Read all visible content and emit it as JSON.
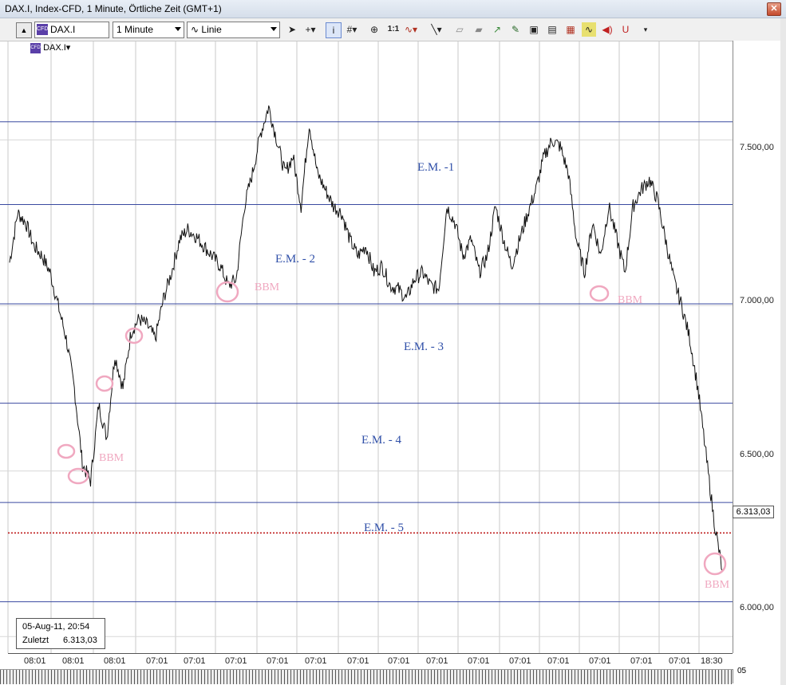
{
  "window": {
    "title": "DAX.I, Index-CFD, 1 Minute, Örtliche Zeit (GMT+1)",
    "close_icon": "close-icon"
  },
  "toolbar": {
    "symbol": "DAX.I",
    "interval": "1 Minute",
    "chart_style": "Linie",
    "icons": [
      "cursor-icon",
      "crosshair-icon",
      "info-icon",
      "grid-icon",
      "zoom-icon",
      "one-to-one-icon",
      "indicator-icon",
      "trendline-icon",
      "eraser-icon",
      "eraser2-icon",
      "fib-icon",
      "draw-icon",
      "copy-icon",
      "paste-icon",
      "print-icon",
      "wave-icon",
      "sound-icon",
      "magnet-icon",
      "more-icon"
    ],
    "one_to_one_label": "1:1"
  },
  "legend": {
    "label": "DAX.I"
  },
  "info": {
    "datetime": "05-Aug-11, 20:54",
    "last_label": "Zuletzt",
    "last_value": "6.313,03"
  },
  "price_axis": {
    "ticks": [
      "7.500,00",
      "7.000,00",
      "6.500,00",
      "6.000,00"
    ],
    "last_price": "6.313,03"
  },
  "time_axis": {
    "ticks": [
      "08:01",
      "08:01",
      "08:01",
      "07:01",
      "07:01",
      "07:01",
      "07:01",
      "07:01",
      "07:01",
      "07:01",
      "07:01",
      "07:01",
      "07:01",
      "07:01",
      "07:01",
      "07:01",
      "07:01",
      "18:30"
    ],
    "corner": "05"
  },
  "annotations": {
    "em": [
      "E.M. -1",
      "E.M. - 2",
      "E.M. - 3",
      "E.M. - 4",
      "E.M. - 5"
    ],
    "bbm": [
      "BBM",
      "BBM",
      "BBM",
      "BBM"
    ]
  },
  "chart_data": {
    "type": "line",
    "series": [
      {
        "values": [
          7130,
          7280,
          7250,
          7180,
          7150,
          7100,
          7000,
          6900,
          6750,
          6520,
          6470,
          6700,
          6600,
          6850,
          6750,
          6920,
          6960,
          6940,
          6900,
          7020,
          7100,
          7200,
          7230,
          7210,
          7180,
          7150,
          7120,
          7060,
          7080,
          7300,
          7400,
          7520,
          7600,
          7500,
          7400,
          7450,
          7300,
          7550,
          7400,
          7350,
          7300,
          7280,
          7200,
          7150,
          7180,
          7100,
          7120,
          7060,
          7050,
          7020,
          7080,
          7100,
          7060,
          7050,
          7300,
          7250,
          7150,
          7200,
          7100,
          7150,
          7300,
          7200,
          7120,
          7200,
          7280,
          7350,
          7450,
          7500,
          7480,
          7400,
          7200,
          7100,
          7250,
          7150,
          7300,
          7200,
          7100,
          7300,
          7350,
          7380,
          7320,
          7200,
          7080,
          7000,
          6900,
          6750,
          6550,
          6350,
          6200
        ]
      }
    ],
    "horizontal_levels": [
      7555,
      7305,
      7005,
      6705,
      6405,
      6105
    ],
    "last_price_line": 6313.03,
    "ylim": [
      5950,
      7800
    ]
  }
}
